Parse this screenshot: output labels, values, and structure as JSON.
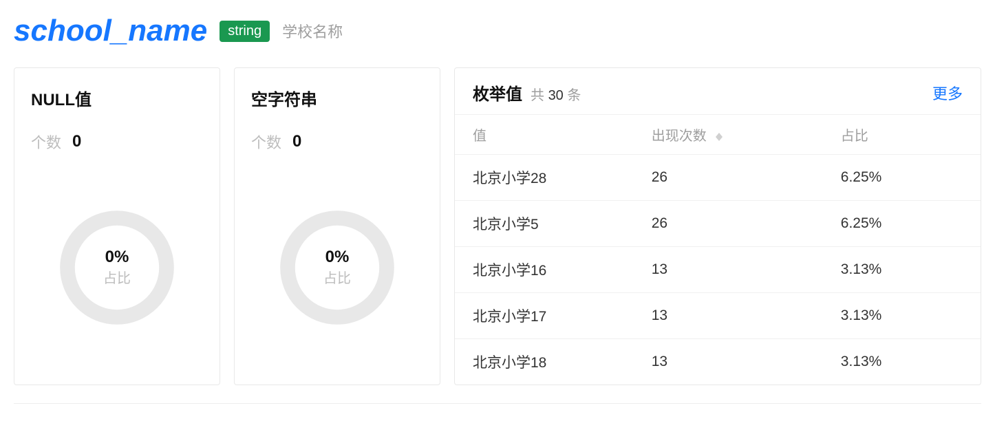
{
  "header": {
    "title": "school_name",
    "type_badge": "string",
    "description": "学校名称"
  },
  "null_card": {
    "title": "NULL值",
    "count_label": "个数",
    "count_value": "0",
    "ring_pct": "0%",
    "ring_label": "占比"
  },
  "empty_card": {
    "title": "空字符串",
    "count_label": "个数",
    "count_value": "0",
    "ring_pct": "0%",
    "ring_label": "占比"
  },
  "enum_card": {
    "title": "枚举值",
    "total_prefix": "共 ",
    "total_count": "30",
    "total_suffix": " 条",
    "more_label": "更多",
    "headers": {
      "value": "值",
      "count": "出现次数",
      "ratio": "占比"
    },
    "rows": [
      {
        "value": "北京小学28",
        "count": "26",
        "ratio": "6.25%"
      },
      {
        "value": "北京小学5",
        "count": "26",
        "ratio": "6.25%"
      },
      {
        "value": "北京小学16",
        "count": "13",
        "ratio": "3.13%"
      },
      {
        "value": "北京小学17",
        "count": "13",
        "ratio": "3.13%"
      },
      {
        "value": "北京小学18",
        "count": "13",
        "ratio": "3.13%"
      }
    ]
  }
}
